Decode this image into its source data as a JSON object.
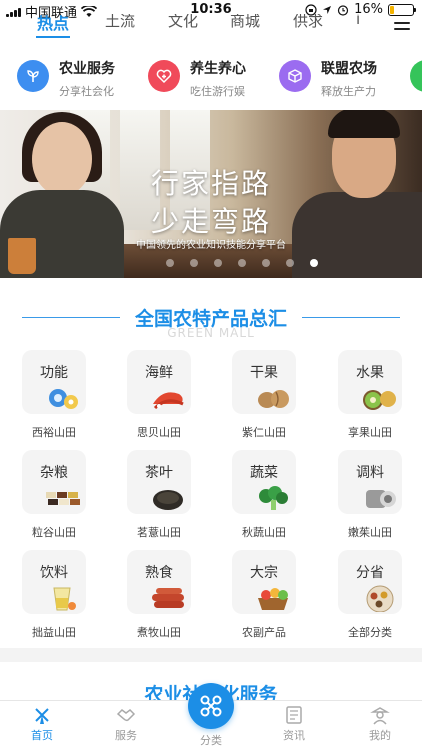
{
  "status_bar": {
    "carrier": "中国联通",
    "time": "10:36",
    "battery_percent": "16%",
    "battery_level": 0.16,
    "icons": [
      "signal-icon",
      "wifi-icon",
      "orientation-lock-icon",
      "location-icon",
      "alarm-icon",
      "battery-icon"
    ]
  },
  "top_tabs": [
    {
      "label": "热点",
      "active": true
    },
    {
      "label": "土流",
      "active": false
    },
    {
      "label": "文化",
      "active": false
    },
    {
      "label": "商城",
      "active": false
    },
    {
      "label": "供求",
      "active": false
    },
    {
      "label": "i",
      "active": false
    }
  ],
  "quick_services": [
    {
      "title": "农业服务",
      "subtitle": "分享社会化",
      "icon": "sprout-icon",
      "color": "#3d8ef0"
    },
    {
      "title": "养生养心",
      "subtitle": "吃住游行娱",
      "icon": "heart-plus-icon",
      "color": "#f04a5a"
    },
    {
      "title": "联盟农场",
      "subtitle": "释放生产力",
      "icon": "cube-icon",
      "color": "#9b6cf0"
    },
    {
      "title": "",
      "subtitle": "",
      "icon": "leaf-icon",
      "color": "#35c45a"
    }
  ],
  "banner": {
    "headline_1": "行家指路",
    "headline_2": "少走弯路",
    "tagline": "中国领先的农业知识技能分享平台",
    "dot_count": 7,
    "active_dot": 6
  },
  "section": {
    "title": "全国农特产品总汇",
    "subtitle_en": "GREEN MALL",
    "accent": "#1c8ee6"
  },
  "products": [
    {
      "label": "功能",
      "caption": "西裕山田",
      "icon": "gear-icon"
    },
    {
      "label": "海鲜",
      "caption": "思贝山田",
      "icon": "shrimp-icon"
    },
    {
      "label": "干果",
      "caption": "紫仁山田",
      "icon": "walnut-icon"
    },
    {
      "label": "水果",
      "caption": "享果山田",
      "icon": "kiwi-icon"
    },
    {
      "label": "杂粮",
      "caption": "粒谷山田",
      "icon": "grain-icon"
    },
    {
      "label": "茶叶",
      "caption": "茗薏山田",
      "icon": "tea-icon"
    },
    {
      "label": "蔬菜",
      "caption": "秋蔬山田",
      "icon": "broccoli-icon"
    },
    {
      "label": "调料",
      "caption": "嫩茱山田",
      "icon": "seasoning-icon"
    },
    {
      "label": "饮料",
      "caption": "拙益山田",
      "icon": "drink-icon"
    },
    {
      "label": "熟食",
      "caption": "煮牧山田",
      "icon": "sausage-icon"
    },
    {
      "label": "大宗",
      "caption": "农副产品",
      "icon": "basket-icon"
    },
    {
      "label": "分省",
      "caption": "全部分类",
      "icon": "spice-plate-icon"
    }
  ],
  "next_section_title": "农业社会化服务",
  "tabbar": {
    "items": [
      {
        "label": "首页",
        "icon": "windmill-icon",
        "active": true
      },
      {
        "label": "服务",
        "icon": "handshake-icon",
        "active": false
      },
      {
        "label": "分类",
        "icon": "category-icon",
        "active": false
      },
      {
        "label": "资讯",
        "icon": "news-icon",
        "active": false
      },
      {
        "label": "我的",
        "icon": "farmer-icon",
        "active": false
      }
    ]
  }
}
